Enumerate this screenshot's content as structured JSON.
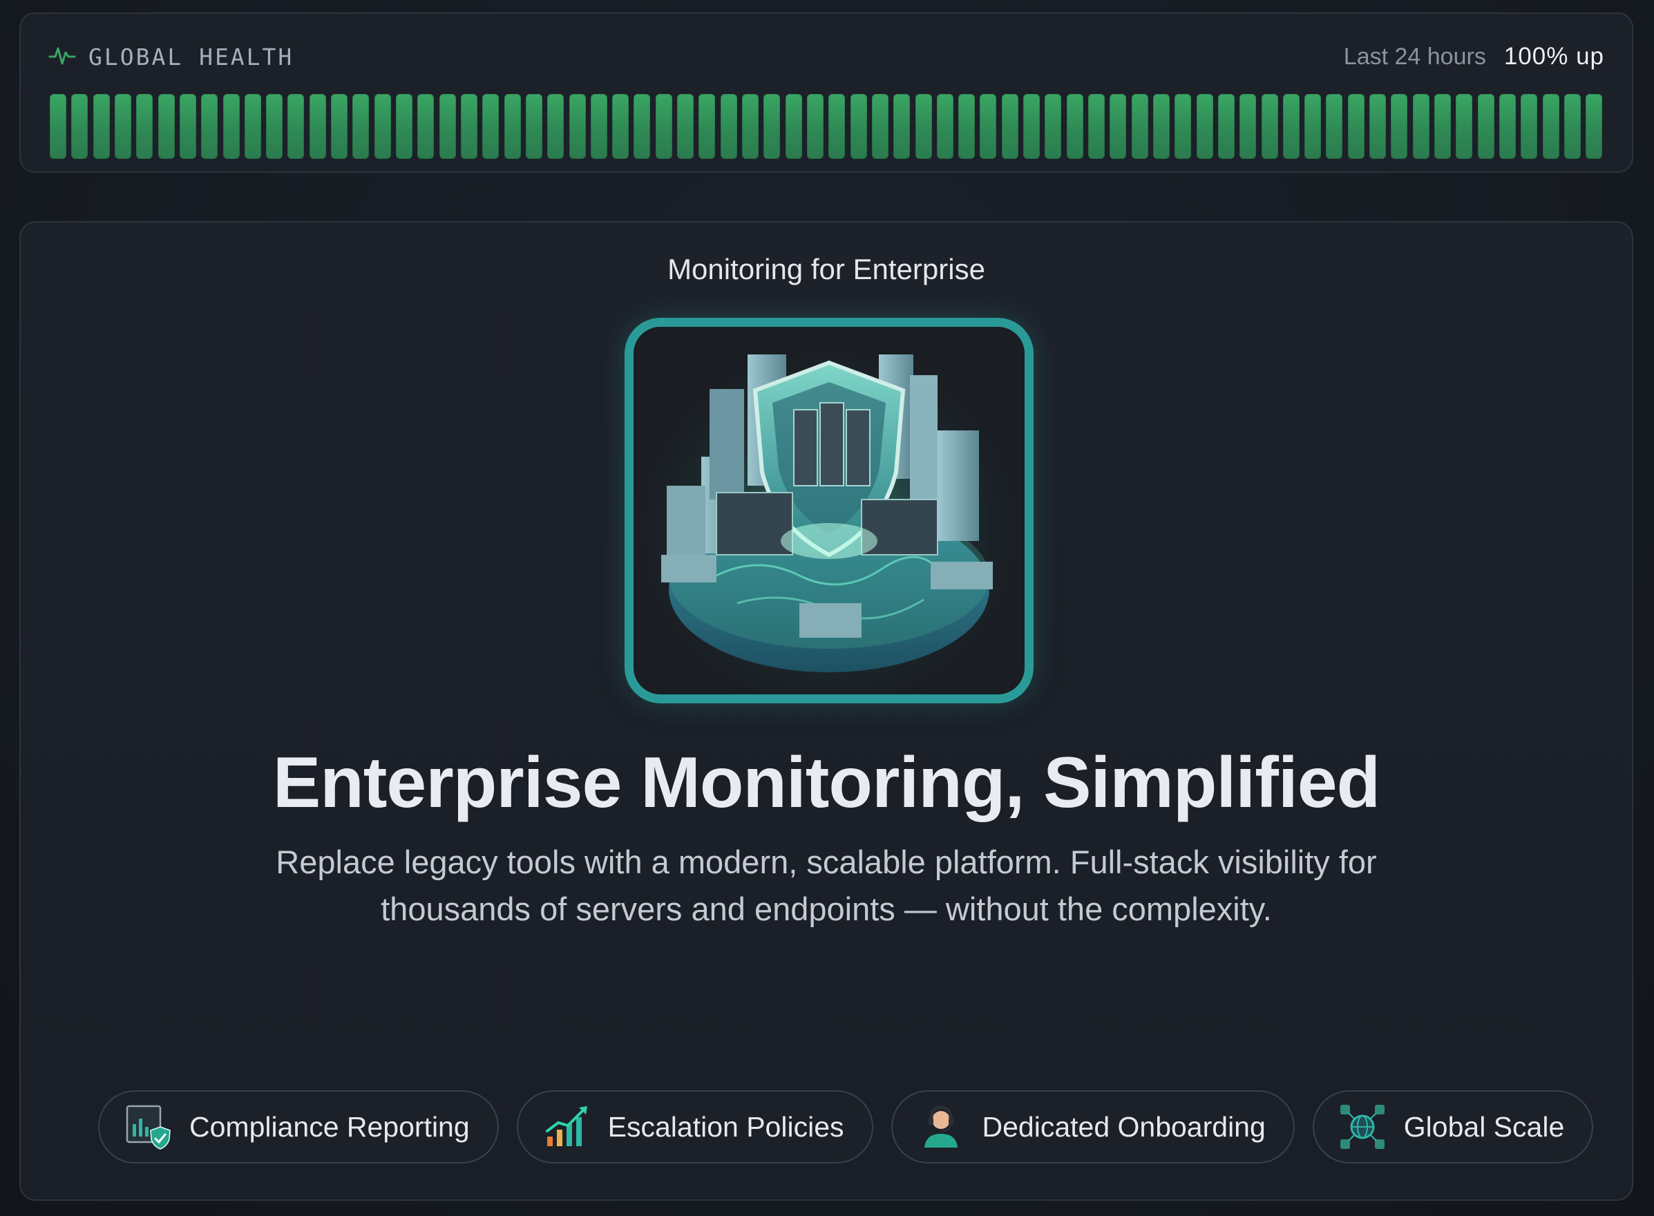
{
  "health": {
    "label": "GLOBAL HEALTH",
    "range": "Last 24 hours",
    "uptime": "100% up",
    "uptime_fraction": 1.0,
    "bar_count": 72,
    "bar_status": "up",
    "colors": {
      "up": "#3aa664",
      "accent": "#2f8a55"
    }
  },
  "hero": {
    "eyebrow": "Monitoring for Enterprise",
    "illustration": "enterprise-city-shield-illustration",
    "headline": "Enterprise Monitoring, Simplified",
    "subtext": "Replace legacy tools with a modern, scalable platform. Full-stack visibility for thousands of servers and endpoints — without the complexity.",
    "accent_color": "#2a9a98"
  },
  "features": [
    {
      "label": "Compliance Reporting",
      "icon": "compliance-report-icon"
    },
    {
      "label": "Escalation Policies",
      "icon": "escalation-chart-icon"
    },
    {
      "label": "Dedicated Onboarding",
      "icon": "support-agent-icon"
    },
    {
      "label": "Global Scale",
      "icon": "globe-network-icon"
    }
  ]
}
